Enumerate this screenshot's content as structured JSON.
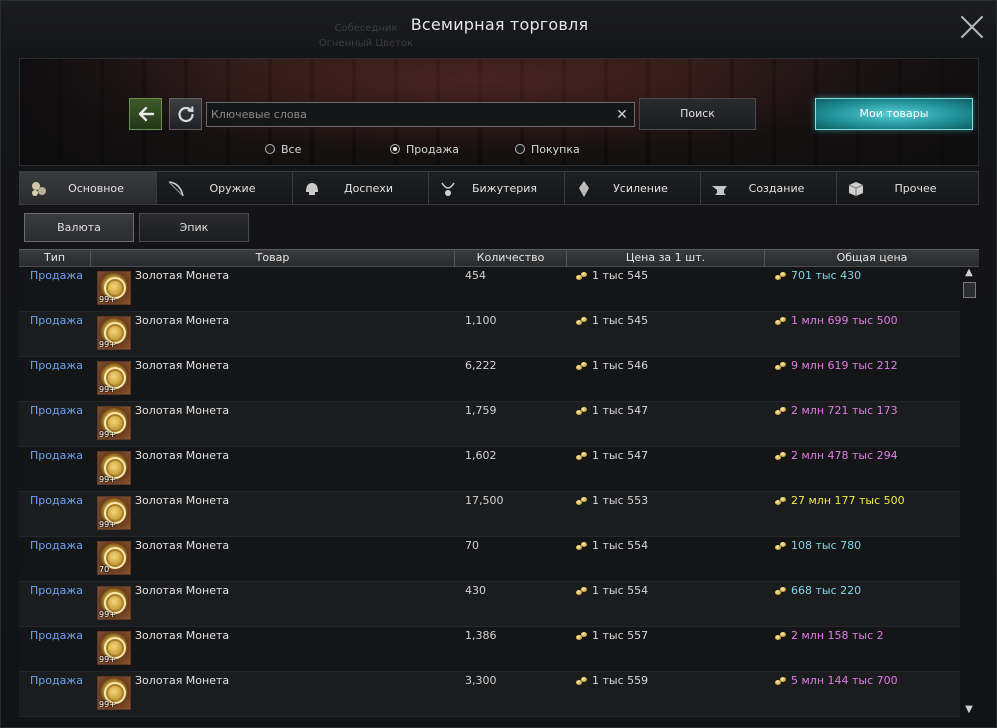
{
  "window": {
    "title": "Всемирная торговля",
    "ghost_lines": [
      "Собеседник",
      "Огненный Цветок"
    ]
  },
  "search": {
    "placeholder": "Ключевые слова",
    "value": "",
    "button": "Поиск",
    "clear_glyph": "✕"
  },
  "my_items_button": "Мои товары",
  "filters": [
    {
      "label": "Все",
      "selected": false
    },
    {
      "label": "Продажа",
      "selected": true
    },
    {
      "label": "Покупка",
      "selected": false
    }
  ],
  "tabs": [
    {
      "label": "Основное",
      "icon": "coins-icon",
      "active": true
    },
    {
      "label": "Оружие",
      "icon": "bow-icon",
      "active": false
    },
    {
      "label": "Доспехи",
      "icon": "helmet-icon",
      "active": false
    },
    {
      "label": "Бижутерия",
      "icon": "necklace-icon",
      "active": false
    },
    {
      "label": "Усиление",
      "icon": "crystal-icon",
      "active": false
    },
    {
      "label": "Создание",
      "icon": "anvil-icon",
      "active": false
    },
    {
      "label": "Прочее",
      "icon": "box-icon",
      "active": false
    }
  ],
  "subcategories": [
    {
      "label": "Валюта",
      "active": true
    },
    {
      "label": "Эпик",
      "active": false
    }
  ],
  "columns": {
    "type": "Тип",
    "item": "Товар",
    "count": "Количество",
    "unit_price": "Цена за 1 шт.",
    "total_price": "Общая цена"
  },
  "colors": {
    "type_link": "#6fa2ef",
    "total_cyan": "#7fd7e8",
    "total_pink": "#e27ce6",
    "total_yellow": "#f0ea4d",
    "accent": "#2fb8c0"
  },
  "rows": [
    {
      "type": "Продажа",
      "item": "Золотая Монета",
      "stack": "99+",
      "count": "454",
      "unit": "1 тыс 545",
      "total": "701 тыс 430",
      "total_color": "#7fd7e8"
    },
    {
      "type": "Продажа",
      "item": "Золотая Монета",
      "stack": "99+",
      "count": "1,100",
      "unit": "1 тыс 545",
      "total": "1 млн 699 тыс 500",
      "total_color": "#e27ce6"
    },
    {
      "type": "Продажа",
      "item": "Золотая Монета",
      "stack": "99+",
      "count": "6,222",
      "unit": "1 тыс 546",
      "total": "9 млн 619 тыс 212",
      "total_color": "#e27ce6"
    },
    {
      "type": "Продажа",
      "item": "Золотая Монета",
      "stack": "99+",
      "count": "1,759",
      "unit": "1 тыс 547",
      "total": "2 млн 721 тыс 173",
      "total_color": "#e27ce6"
    },
    {
      "type": "Продажа",
      "item": "Золотая Монета",
      "stack": "99+",
      "count": "1,602",
      "unit": "1 тыс 547",
      "total": "2 млн 478 тыс 294",
      "total_color": "#e27ce6"
    },
    {
      "type": "Продажа",
      "item": "Золотая Монета",
      "stack": "99+",
      "count": "17,500",
      "unit": "1 тыс 553",
      "total": "27 млн 177 тыс 500",
      "total_color": "#f0ea4d"
    },
    {
      "type": "Продажа",
      "item": "Золотая Монета",
      "stack": "70",
      "count": "70",
      "unit": "1 тыс 554",
      "total": "108 тыс 780",
      "total_color": "#7fd7e8"
    },
    {
      "type": "Продажа",
      "item": "Золотая Монета",
      "stack": "99+",
      "count": "430",
      "unit": "1 тыс 554",
      "total": "668 тыс 220",
      "total_color": "#7fd7e8"
    },
    {
      "type": "Продажа",
      "item": "Золотая Монета",
      "stack": "99+",
      "count": "1,386",
      "unit": "1 тыс 557",
      "total": "2 млн 158 тыс 2",
      "total_color": "#e27ce6"
    },
    {
      "type": "Продажа",
      "item": "Золотая Монета",
      "stack": "99+",
      "count": "3,300",
      "unit": "1 тыс 559",
      "total": "5 млн 144 тыс 700",
      "total_color": "#e27ce6"
    }
  ]
}
